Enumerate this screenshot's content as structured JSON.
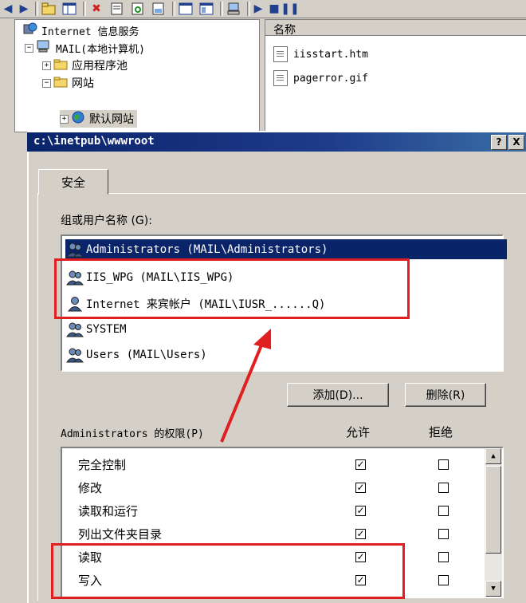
{
  "mmc": {
    "tree": [
      {
        "label": "Internet 信息服务",
        "icon": "iis-icon",
        "level": 0
      },
      {
        "label": "MAIL(本地计算机)",
        "icon": "computer-icon",
        "level": 1,
        "expander": "−"
      },
      {
        "label": "应用程序池",
        "icon": "folder-icon",
        "level": 2,
        "expander": "+"
      },
      {
        "label": "网站",
        "icon": "folder-icon",
        "level": 2,
        "expander": "−"
      },
      {
        "label": "默认网站",
        "icon": "globe-icon",
        "level": 3,
        "expander": "+"
      }
    ],
    "list_header": "名称",
    "files": [
      "iisstart.htm",
      "pagerror.gif"
    ]
  },
  "dialog": {
    "title": "c:\\inetpub\\wwwroot",
    "help_button": "?",
    "close_button": "X",
    "tab": "安全",
    "users_label": "组或用户名称 (G):",
    "users": [
      {
        "label": "Administrators (MAIL\\Administrators)",
        "selected": true
      },
      {
        "label": "IIS_WPG (MAIL\\IIS_WPG)",
        "selected": false
      },
      {
        "label": "Internet 来宾帐户 (MAIL\\IUSR_......Q)",
        "selected": false
      },
      {
        "label": "SYSTEM",
        "selected": false
      },
      {
        "label": "Users (MAIL\\Users)",
        "selected": false
      }
    ],
    "add_button": "添加(D)...",
    "remove_button": "删除(R)",
    "perm_label": "Administrators 的权限(P)",
    "allow_header": "允许",
    "deny_header": "拒绝",
    "permissions": [
      {
        "name": "完全控制",
        "allow": true,
        "deny": false
      },
      {
        "name": "修改",
        "allow": true,
        "deny": false
      },
      {
        "name": "读取和运行",
        "allow": true,
        "deny": false
      },
      {
        "name": "列出文件夹目录",
        "allow": true,
        "deny": false
      },
      {
        "name": "读取",
        "allow": true,
        "deny": false
      },
      {
        "name": "写入",
        "allow": true,
        "deny": false
      }
    ]
  },
  "annotation_color": "#e02020"
}
